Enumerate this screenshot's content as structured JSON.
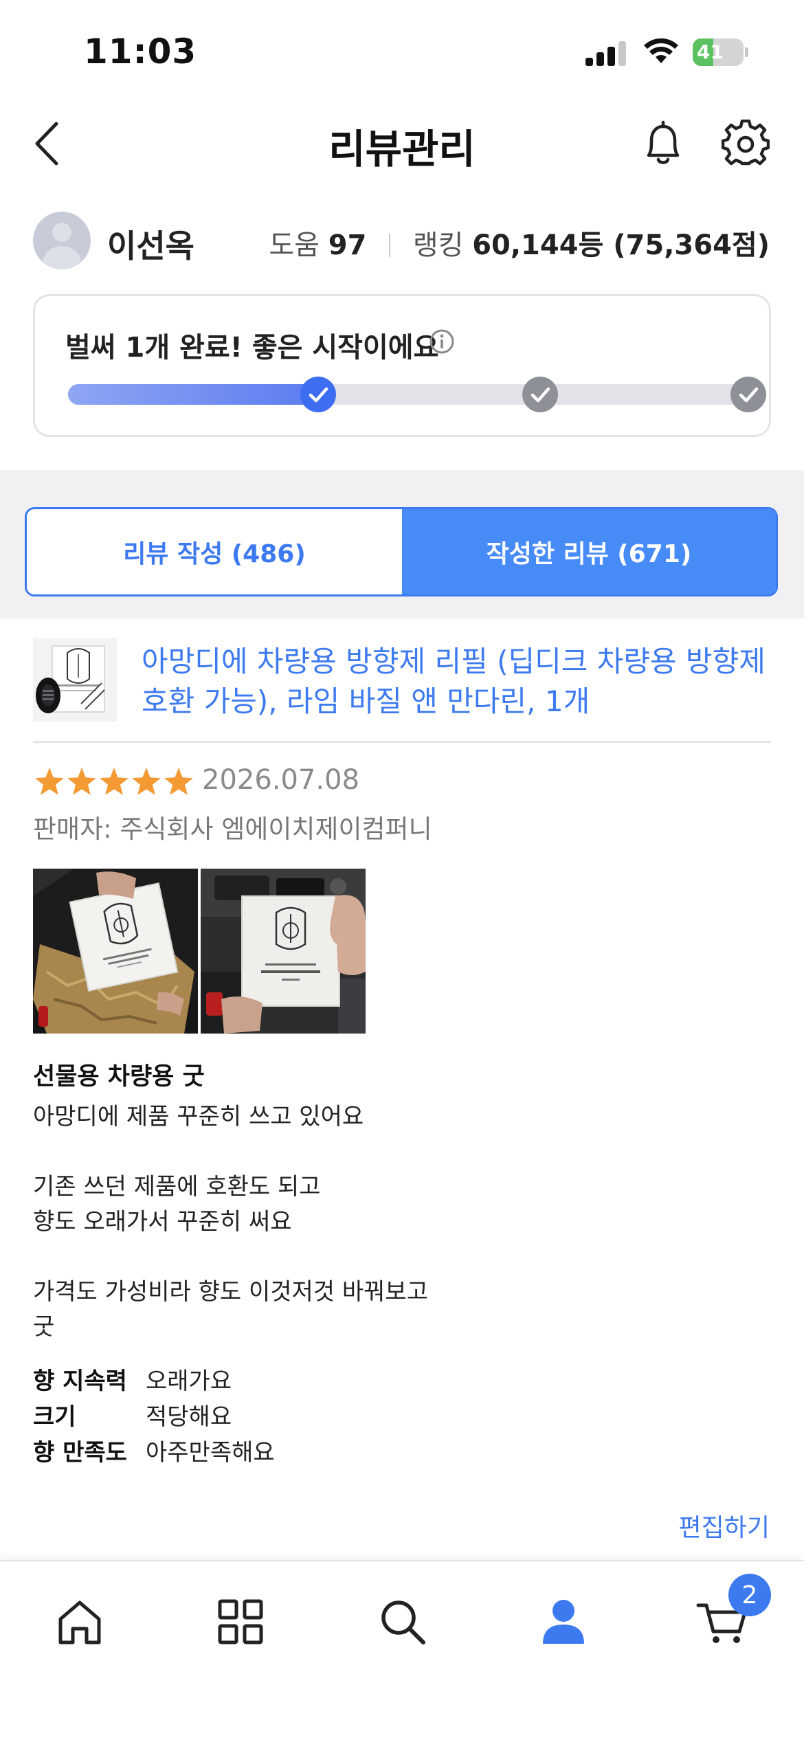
{
  "status_bar": {
    "time": "11:03",
    "battery": "41",
    "battery_level": 0.41
  },
  "header": {
    "title": "리뷰관리"
  },
  "profile": {
    "name": "이선옥",
    "help_label": "도움",
    "help_value": "97",
    "rank_label": "랭킹",
    "rank_value": "60,144등 (75,364점)"
  },
  "progress": {
    "message": "벌써 1개 완료! 좋은 시작이에요",
    "completed_steps": 1,
    "total_steps": 3
  },
  "tabs": [
    {
      "label": "리뷰 작성 (486)",
      "active": false
    },
    {
      "label": "작성한 리뷰 (671)",
      "active": true
    }
  ],
  "review": {
    "product_name": "아망디에 차량용 방향제 리필 (딥디크 차량용 방향제 호환 가능), 라임 바질 앤 만다린, 1개",
    "rating": 5,
    "date": "2026.07.08",
    "seller": "판매자: 주식회사 엠에이치제이컴퍼니",
    "title": "선물용 차량용 굿",
    "body": "아망디에 제품 꾸준히 쓰고 있어요\n\n기존 쓰던 제품에 호환도 되고\n향도 오래가서 꾸준히 써요\n\n가격도 가성비라 향도 이것저것 바꿔보고\n굿",
    "attributes": [
      {
        "key": "향 지속력",
        "value": "오래가요"
      },
      {
        "key": "크기",
        "value": "적당해요"
      },
      {
        "key": "향 만족도",
        "value": "아주만족해요"
      }
    ],
    "edit_label": "편집하기"
  },
  "tabbar": {
    "items": [
      "home-icon",
      "categories-icon",
      "search-icon",
      "my-page-icon",
      "cart-icon"
    ],
    "cart_count": "2"
  },
  "colors": {
    "accent": "#3d7af0",
    "star": "#f39a34",
    "battery": "#5cc261"
  }
}
